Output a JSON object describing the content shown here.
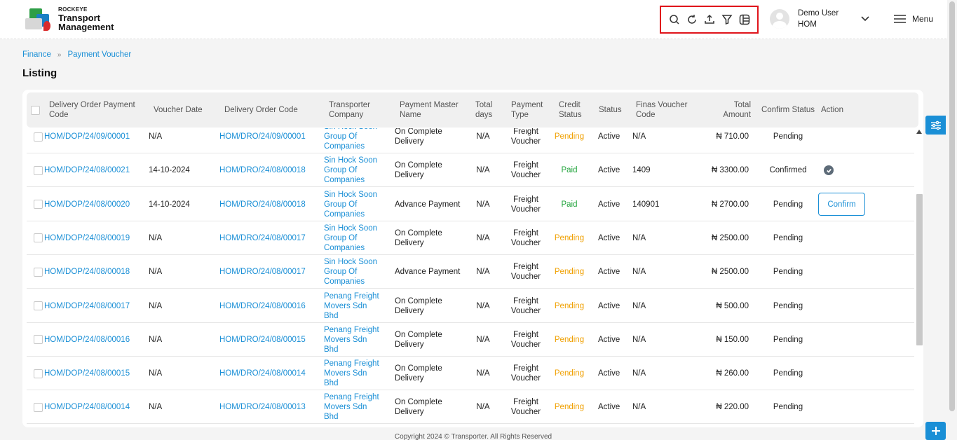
{
  "app": {
    "logo_small": "ROCKEYE",
    "logo_line1": "Transport",
    "logo_line2": "Management"
  },
  "toolbar": {
    "icons": [
      "search-icon",
      "refresh-icon",
      "upload-icon",
      "filter-icon",
      "columns-icon"
    ]
  },
  "user": {
    "name": "Demo User",
    "branch": "HOM",
    "menu_label": "Menu"
  },
  "breadcrumb": {
    "parent": "Finance",
    "current": "Payment Voucher"
  },
  "page": {
    "title": "Listing"
  },
  "table": {
    "headers": {
      "code": "Delivery Order Payment Code",
      "voucher_date": "Voucher Date",
      "do_code": "Delivery Order Code",
      "transporter": "Transporter Company",
      "payment_master": "Payment Master Name",
      "total_days": "Total days",
      "payment_type": "Payment Type",
      "credit_status": "Credit Status",
      "status": "Status",
      "finas": "Finas Voucher Code",
      "total_amount": "Total Amount",
      "confirm_status": "Confirm Status",
      "action": "Action"
    },
    "rows": [
      {
        "code": "HOM/DOP/24/09/00001",
        "voucher_date": "N/A",
        "do_code": "HOM/DRO/24/09/00001",
        "transporter": "Sin Hock Soon Group Of Companies",
        "payment_master": "On Complete Delivery",
        "total_days": "N/A",
        "payment_type": "Freight Voucher",
        "credit_status": "Pending",
        "status": "Active",
        "finas": "N/A",
        "total_amount": "₦ 710.00",
        "confirm_status": "Pending",
        "action": ""
      },
      {
        "code": "HOM/DOP/24/08/00021",
        "voucher_date": "14-10-2024",
        "do_code": "HOM/DRO/24/08/00018",
        "transporter": "Sin Hock Soon Group Of Companies",
        "payment_master": "On Complete Delivery",
        "total_days": "N/A",
        "payment_type": "Freight Voucher",
        "credit_status": "Paid",
        "status": "Active",
        "finas": "1409",
        "total_amount": "₦ 3300.00",
        "confirm_status": "Confirmed",
        "action": "check"
      },
      {
        "code": "HOM/DOP/24/08/00020",
        "voucher_date": "14-10-2024",
        "do_code": "HOM/DRO/24/08/00018",
        "transporter": "Sin Hock Soon Group Of Companies",
        "payment_master": "Advance Payment",
        "total_days": "N/A",
        "payment_type": "Freight Voucher",
        "credit_status": "Paid",
        "status": "Active",
        "finas": "140901",
        "total_amount": "₦ 2700.00",
        "confirm_status": "Pending",
        "action": "Confirm"
      },
      {
        "code": "HOM/DOP/24/08/00019",
        "voucher_date": "N/A",
        "do_code": "HOM/DRO/24/08/00017",
        "transporter": "Sin Hock Soon Group Of Companies",
        "payment_master": "On Complete Delivery",
        "total_days": "N/A",
        "payment_type": "Freight Voucher",
        "credit_status": "Pending",
        "status": "Active",
        "finas": "N/A",
        "total_amount": "₦ 2500.00",
        "confirm_status": "Pending",
        "action": ""
      },
      {
        "code": "HOM/DOP/24/08/00018",
        "voucher_date": "N/A",
        "do_code": "HOM/DRO/24/08/00017",
        "transporter": "Sin Hock Soon Group Of Companies",
        "payment_master": "Advance Payment",
        "total_days": "N/A",
        "payment_type": "Freight Voucher",
        "credit_status": "Pending",
        "status": "Active",
        "finas": "N/A",
        "total_amount": "₦ 2500.00",
        "confirm_status": "Pending",
        "action": ""
      },
      {
        "code": "HOM/DOP/24/08/00017",
        "voucher_date": "N/A",
        "do_code": "HOM/DRO/24/08/00016",
        "transporter": "Penang Freight Movers Sdn Bhd",
        "payment_master": "On Complete Delivery",
        "total_days": "N/A",
        "payment_type": "Freight Voucher",
        "credit_status": "Pending",
        "status": "Active",
        "finas": "N/A",
        "total_amount": "₦ 500.00",
        "confirm_status": "Pending",
        "action": ""
      },
      {
        "code": "HOM/DOP/24/08/00016",
        "voucher_date": "N/A",
        "do_code": "HOM/DRO/24/08/00015",
        "transporter": "Penang Freight Movers Sdn Bhd",
        "payment_master": "On Complete Delivery",
        "total_days": "N/A",
        "payment_type": "Freight Voucher",
        "credit_status": "Pending",
        "status": "Active",
        "finas": "N/A",
        "total_amount": "₦ 150.00",
        "confirm_status": "Pending",
        "action": ""
      },
      {
        "code": "HOM/DOP/24/08/00015",
        "voucher_date": "N/A",
        "do_code": "HOM/DRO/24/08/00014",
        "transporter": "Penang Freight Movers Sdn Bhd",
        "payment_master": "On Complete Delivery",
        "total_days": "N/A",
        "payment_type": "Freight Voucher",
        "credit_status": "Pending",
        "status": "Active",
        "finas": "N/A",
        "total_amount": "₦ 260.00",
        "confirm_status": "Pending",
        "action": ""
      },
      {
        "code": "HOM/DOP/24/08/00014",
        "voucher_date": "N/A",
        "do_code": "HOM/DRO/24/08/00013",
        "transporter": "Penang Freight Movers Sdn Bhd",
        "payment_master": "On Complete Delivery",
        "total_days": "N/A",
        "payment_type": "Freight Voucher",
        "credit_status": "Pending",
        "status": "Active",
        "finas": "N/A",
        "total_amount": "₦ 220.00",
        "confirm_status": "Pending",
        "action": ""
      }
    ]
  },
  "footer": {
    "text": "Copyright 2024 © Transporter. All Rights Reserved"
  },
  "colors": {
    "accent": "#1a8fd6",
    "pending": "#f0a000",
    "paid": "#1fa33a",
    "highlight": "#e0141b"
  }
}
